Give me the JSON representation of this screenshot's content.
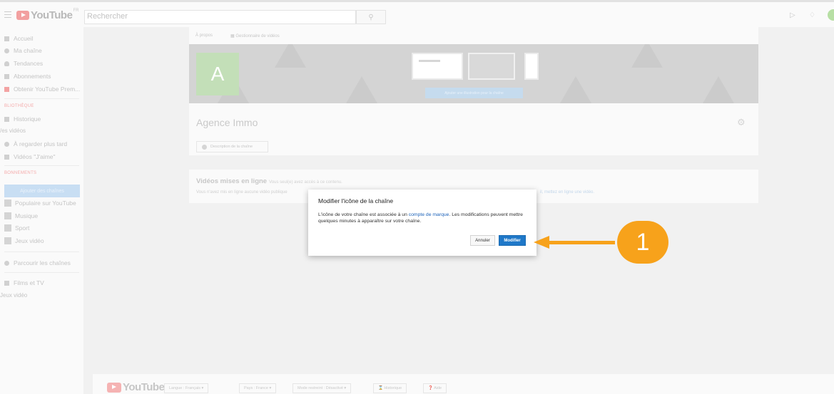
{
  "header": {
    "logo_text": "YouTube",
    "logo_sup": "FR",
    "search_placeholder": "Rechercher"
  },
  "sidebar": {
    "items": [
      {
        "label": "Accueil",
        "icon": "home-icon"
      },
      {
        "label": "Ma chaîne",
        "icon": "person-icon"
      },
      {
        "label": "Tendances",
        "icon": "flame-icon"
      },
      {
        "label": "Abonnements",
        "icon": "subscriptions-icon"
      },
      {
        "label": "Obtenir YouTube Prem...",
        "icon": "youtube-icon"
      }
    ],
    "library_heading": "BLIOTHÈQUE",
    "library_items": [
      {
        "label": "Historique",
        "icon": "hourglass-icon"
      }
    ],
    "mes_videos": "/es vidéos",
    "library_items_2": [
      {
        "label": "À regarder plus tard",
        "icon": "clock-icon"
      },
      {
        "label": "Vidéos \"J'aime\"",
        "icon": "thumbs-up-icon"
      }
    ],
    "subs_heading": "BONNEMENTS",
    "add_channels_button": "Ajouter des chaînes",
    "channels": [
      {
        "label": "Populaire sur YouTube"
      },
      {
        "label": "Musique"
      },
      {
        "label": "Sport"
      },
      {
        "label": "Jeux vidéo"
      }
    ],
    "browse_channels": "Parcourir les chaînes",
    "films_tv": "Films et TV",
    "jeux_video": "Jeux vidéo"
  },
  "channel": {
    "tab_about": "À propos",
    "tab_manager": "Gestionnaire de vidéos",
    "avatar_letter": "A",
    "add_art_button": "Ajouter une illustration pour la chaîne",
    "name": "Agence Immo",
    "description_button": "Description de la chaîne"
  },
  "videos_section": {
    "title": "Vidéos mises en ligne",
    "subtitle": "Vous seul(e) avez accès à ce contenu.",
    "text": "Vous n'avez mis en ligne aucune vidéo publique",
    "link": "il, mettez en ligne une vidéo."
  },
  "dialog": {
    "title": "Modifier l'icône de la chaîne",
    "body_before_link": "L'icône de votre chaîne est associée à un ",
    "body_link": "compte de marque",
    "body_after_link": ". Les modifications peuvent mettre quelques minutes à apparaître sur votre chaîne.",
    "cancel_label": "Annuler",
    "confirm_label": "Modifier"
  },
  "footer": {
    "logo_text": "YouTube",
    "language": "Langue : Français",
    "country": "Pays : France",
    "restricted": "Mode restreint : Désactivé",
    "history": "Historique",
    "help": "Aide"
  },
  "annotation": {
    "step_number": "1",
    "color": "#f7a21b"
  }
}
